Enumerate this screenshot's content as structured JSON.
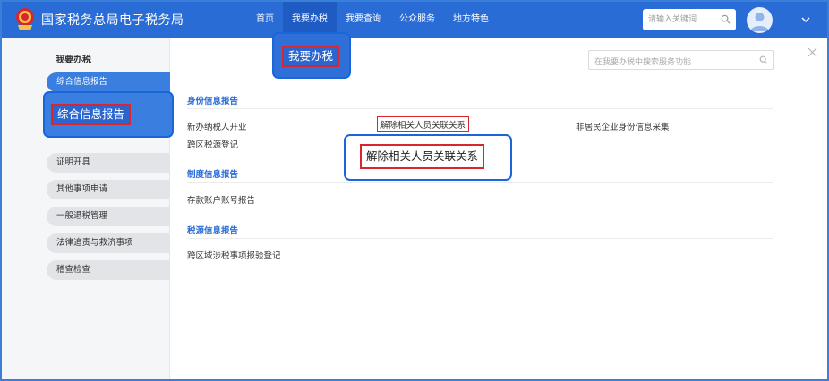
{
  "header": {
    "site_title": "国家税务总局电子税务局",
    "nav": [
      "首页",
      "我要办税",
      "我要查询",
      "公众服务",
      "地方特色"
    ],
    "active_nav": 1,
    "search_placeholder": "请输入关键词"
  },
  "sidebar": {
    "title": "我要办税",
    "items": [
      {
        "label": "综合信息报告",
        "active": true
      },
      {
        "label": "证明开具",
        "active": false
      },
      {
        "label": "其他事项申请",
        "active": false
      },
      {
        "label": "一般退税管理",
        "active": false
      },
      {
        "label": "法律追责与救济事项",
        "active": false
      },
      {
        "label": "稽查检查",
        "active": false
      }
    ]
  },
  "main": {
    "search_placeholder": "在我要办税中搜索服务功能",
    "sections": [
      {
        "title": "身份信息报告",
        "links": [
          "新办纳税人开业",
          "解除相关人员关联关系",
          "非居民企业身份信息采集",
          "跨区税源登记"
        ]
      },
      {
        "title": "制度信息报告",
        "links": [
          "存款账户账号报告"
        ]
      },
      {
        "title": "税源信息报告",
        "links": [
          "跨区域涉税事项报验登记"
        ]
      }
    ]
  },
  "callouts": {
    "nav": "我要办税",
    "sidebar": "综合信息报告",
    "link": "解除相关人员关联关系"
  },
  "colors": {
    "header_bg": "#2a6cd6",
    "nav_active_bg": "#1e5cc3",
    "sidebar_active": "#3a7fe0",
    "section_title": "#2a6cd6",
    "highlight_red": "#d9262c",
    "callout_blue": "#1a66d9"
  }
}
